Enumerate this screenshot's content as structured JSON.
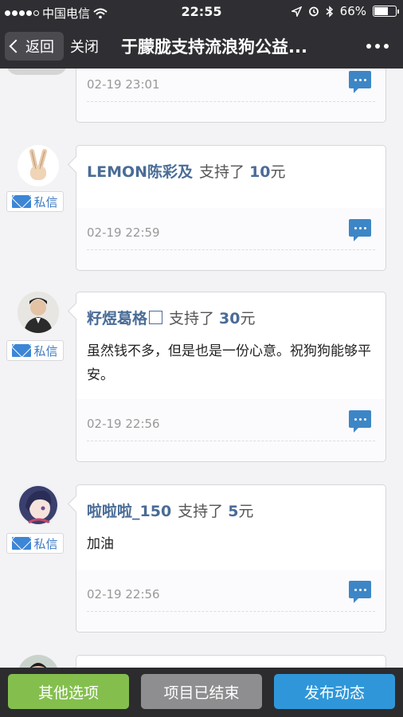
{
  "status_bar": {
    "carrier": "中国电信",
    "time": "22:55",
    "battery_text": "66%",
    "battery_level": 0.66
  },
  "nav": {
    "back_label": "返回",
    "close_label": "关闭",
    "title": "于朦胧支持流浪狗公益..."
  },
  "feed": {
    "support_text": "支持了",
    "pm_label": "私信",
    "entries": [
      {
        "name": "",
        "amount": "",
        "comment": "",
        "timestamp": "02-19 23:01"
      },
      {
        "name": "LEMON陈彩及",
        "amount": "10",
        "unit": "元",
        "comment": "",
        "timestamp": "02-19 22:59"
      },
      {
        "name": "籽煜葛格",
        "amount": "30",
        "unit": "元",
        "comment": "虽然钱不多，但是也是一份心意。祝狗狗能够平安。",
        "timestamp": "02-19 22:56"
      },
      {
        "name": "啦啦啦_150",
        "amount": "5",
        "unit": "元",
        "comment": "加油",
        "timestamp": "02-19 22:56"
      }
    ]
  },
  "bottom": {
    "other_label": "其他选项",
    "ended_label": "项目已结束",
    "publish_label": "发布动态"
  },
  "colors": {
    "other": "#84bf4e",
    "ended": "#8e8e90",
    "publish": "#2f97d9"
  }
}
